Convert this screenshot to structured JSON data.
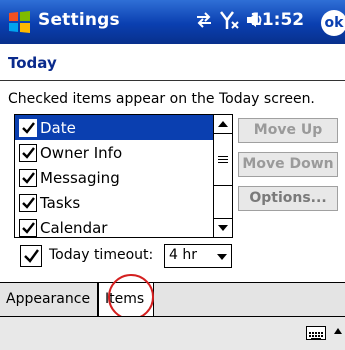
{
  "titlebar": {
    "title": "Settings",
    "time": "11:52",
    "ok_label": "ok",
    "icons": [
      "windows-start-icon",
      "connectivity-icon",
      "signal-off-icon",
      "speaker-icon"
    ]
  },
  "page": {
    "heading": "Today",
    "instruction": "Checked items appear on the Today screen."
  },
  "items_list": {
    "items": [
      {
        "label": "Date",
        "checked": true,
        "selected": true
      },
      {
        "label": "Owner Info",
        "checked": true,
        "selected": false
      },
      {
        "label": "Messaging",
        "checked": true,
        "selected": false
      },
      {
        "label": "Tasks",
        "checked": true,
        "selected": false
      },
      {
        "label": "Calendar",
        "checked": true,
        "selected": false
      }
    ]
  },
  "buttons": {
    "move_up": "Move Up",
    "move_down": "Move Down",
    "options": "Options..."
  },
  "timeout": {
    "checked": true,
    "label": "Today timeout:",
    "value": "4 hr"
  },
  "tabs": [
    {
      "label": "Appearance",
      "active": false
    },
    {
      "label": "Items",
      "active": true
    }
  ],
  "colors": {
    "titlebar": "#0a3fb0",
    "selection": "#0a3fb0",
    "heading": "#0a2a8c",
    "highlight_circle": "#d42020"
  },
  "bottom_bar": {
    "icons": [
      "keyboard-icon",
      "input-menu-arrow-icon"
    ]
  }
}
